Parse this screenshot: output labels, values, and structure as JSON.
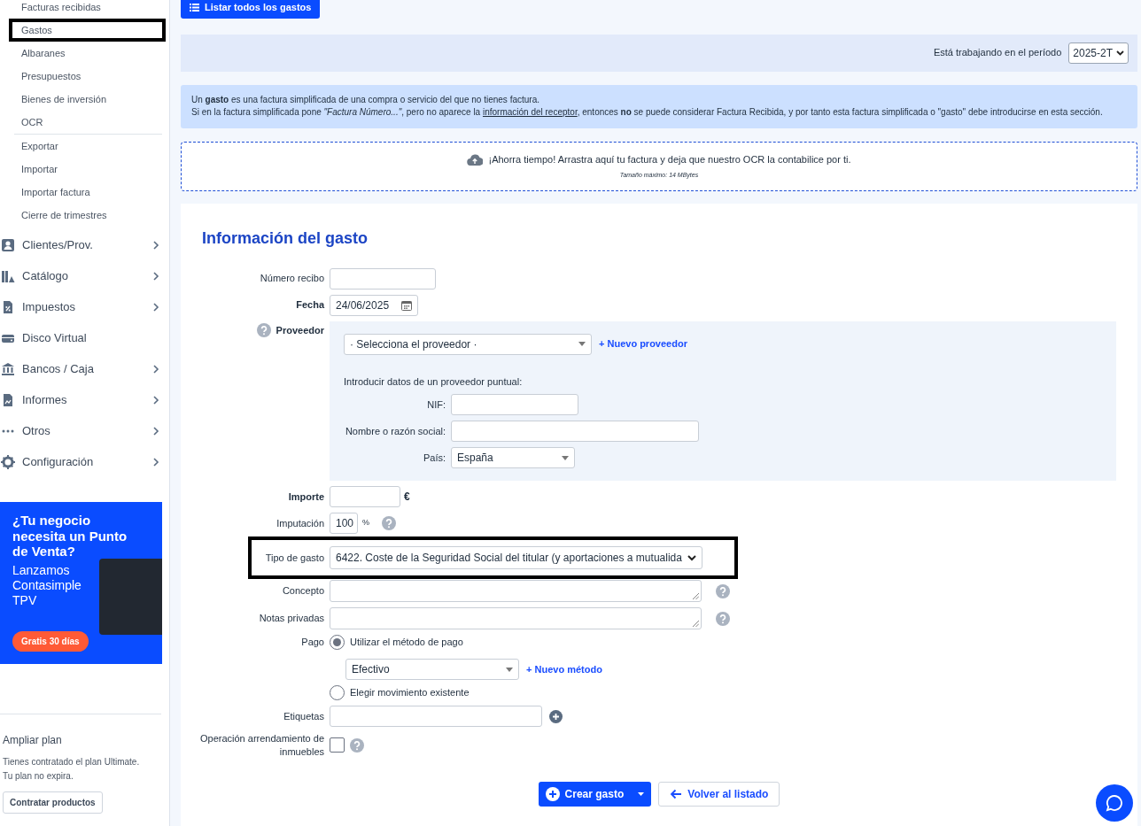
{
  "sidebar": {
    "sub_groups": [
      [
        {
          "label": "Facturas recibidas",
          "highlighted": false
        },
        {
          "label": "Gastos",
          "highlighted": true
        },
        {
          "label": "Albaranes",
          "highlighted": false
        },
        {
          "label": "Presupuestos",
          "highlighted": false
        },
        {
          "label": "Bienes de inversión",
          "highlighted": false
        },
        {
          "label": "OCR",
          "highlighted": false
        }
      ],
      [
        {
          "label": "Exportar",
          "highlighted": false
        },
        {
          "label": "Importar",
          "highlighted": false
        },
        {
          "label": "Importar factura",
          "highlighted": false
        },
        {
          "label": "Cierre de trimestres",
          "highlighted": false
        }
      ]
    ],
    "items": [
      {
        "label": "Clientes/Prov.",
        "kind": "contact",
        "has_submenu": true
      },
      {
        "label": "Catálogo",
        "kind": "catalog",
        "has_submenu": true
      },
      {
        "label": "Impuestos",
        "kind": "taxes",
        "has_submenu": true
      },
      {
        "label": "Disco Virtual",
        "kind": "disk",
        "has_submenu": false
      },
      {
        "label": "Bancos / Caja",
        "kind": "bank",
        "has_submenu": true
      },
      {
        "label": "Informes",
        "kind": "reports",
        "has_submenu": true
      },
      {
        "label": "Otros",
        "kind": "more",
        "has_submenu": true
      },
      {
        "label": "Configuración",
        "kind": "gear",
        "has_submenu": true
      }
    ],
    "promo": {
      "headline": "¿Tu negocio necesita un Punto de Venta?",
      "text": "Lanzamos Contasimple TPV",
      "button": "Gratis 30 días"
    },
    "plan": {
      "title": "Ampliar plan",
      "lines": [
        "Tienes contratado el plan Ultimate.",
        "Tu plan no expira."
      ],
      "button": "Contratar productos"
    }
  },
  "toolbar": {
    "button": "Listar todos los gastos"
  },
  "period": {
    "label": "Está trabajando en el período",
    "value": "2025-2T"
  },
  "info": {
    "line_1": "Un **gasto** es una factura simplificada de una compra o servicio del que no tienes factura.",
    "line_2_before": "Si en la factura simplificada pone *\"Factura Número...\"*, pero no aparece la ",
    "link": "información del receptor",
    "line_2_after": ", entonces **no** se puede considerar Factura Recibida, y por tanto esta factura simplificada o \"gasto\" debe introducirse en esta sección."
  },
  "dropzone": {
    "text": "¡Ahorra tiempo! Arrastra aquí tu factura y deja que nuestro OCR la contabilice por ti.",
    "note": "Tamaño máximo: 14 MBytes"
  },
  "form": {
    "title": "Información del gasto",
    "fields": [
      {
        "kind": "text",
        "label": "Número recibo",
        "required": false
      },
      {
        "kind": "date",
        "label": "Fecha",
        "required": true,
        "value": "24/06/2025"
      },
      {
        "kind": "supplier",
        "label": "Proveedor",
        "required": true,
        "help": true,
        "select": "· Selecciona el proveedor ·",
        "link": "+ Nuevo proveedor",
        "intro": "Introducir datos de un proveedor puntual:",
        "subfields": [
          {
            "kind": "text",
            "label": "NIF:"
          },
          {
            "kind": "wide",
            "label": "Nombre o razón social:"
          },
          {
            "kind": "select",
            "label": "País:",
            "value": "España"
          }
        ]
      },
      {
        "kind": "amount",
        "label": "Importe",
        "required": true,
        "unit": "€"
      },
      {
        "kind": "percent",
        "label": "Imputación",
        "required": false,
        "value": "100",
        "unit": "%",
        "help": true
      },
      {
        "kind": "select",
        "label": "Tipo de gasto",
        "required": false,
        "value": "6422. Coste de la Seguridad Social del titular (y aportaciones a mutualida",
        "highlighted": true
      },
      {
        "kind": "textarea",
        "label": "Concepto",
        "required": false,
        "help": true
      },
      {
        "kind": "textarea",
        "label": "Notas privadas",
        "required": false,
        "help": true
      },
      {
        "kind": "payment",
        "label": "Pago",
        "required": false,
        "options": [
          {
            "label": "Utilizar el método de pago",
            "selected": true,
            "method": "Efectivo",
            "link": "+ Nuevo método"
          },
          {
            "label": "Elegir movimiento existente",
            "selected": false
          }
        ]
      },
      {
        "kind": "tags",
        "label": "Etiquetas",
        "required": false
      },
      {
        "kind": "checkbox",
        "label": "Operación arrendamiento de inmuebles",
        "required": false,
        "checked": false,
        "help": true
      }
    ],
    "buttons": [
      {
        "kind": "primary",
        "label": "Crear gasto"
      },
      {
        "kind": "back",
        "label": "Volver al listado"
      }
    ]
  }
}
